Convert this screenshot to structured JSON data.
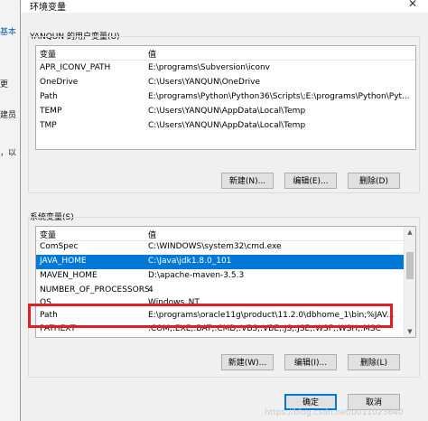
{
  "background_window": {
    "fragments": [
      {
        "text": "基本"
      },
      {
        "text": "更"
      },
      {
        "text": "建员"
      },
      {
        "text": "，以"
      }
    ]
  },
  "dialog": {
    "title": "环境变量",
    "close_glyph": "✕"
  },
  "user_vars": {
    "group_label": "YANQUN 的用户变量(U)",
    "columns": {
      "name": "变量",
      "value": "值"
    },
    "rows": [
      {
        "name": "APR_ICONV_PATH",
        "value": "E:\\programs\\Subversion\\iconv"
      },
      {
        "name": "OneDrive",
        "value": "C:\\Users\\YANQUN\\OneDrive"
      },
      {
        "name": "Path",
        "value": "E:\\programs\\Python\\Python36\\Scripts\\;E:\\programs\\Python\\Pyt..."
      },
      {
        "name": "TEMP",
        "value": "C:\\Users\\YANQUN\\AppData\\Local\\Temp"
      },
      {
        "name": "TMP",
        "value": "C:\\Users\\YANQUN\\AppData\\Local\\Temp"
      }
    ],
    "buttons": {
      "new": "新建(N)...",
      "edit": "编辑(E)...",
      "delete": "删除(D)"
    }
  },
  "system_vars": {
    "group_label": "系统变量(S)",
    "columns": {
      "name": "变量",
      "value": "值"
    },
    "rows": [
      {
        "name": "ComSpec",
        "value": "C:\\WINDOWS\\system32\\cmd.exe"
      },
      {
        "name": "JAVA_HOME",
        "value": "C:\\Java\\jdk1.8.0_101"
      },
      {
        "name": "MAVEN_HOME",
        "value": "D:\\apache-maven-3.5.3"
      },
      {
        "name": "NUMBER_OF_PROCESSORS",
        "value": "4"
      },
      {
        "name": "OS",
        "value": "Windows_NT"
      },
      {
        "name": "Path",
        "value": "E:\\programs\\oracle11g\\product\\11.2.0\\dbhome_1\\bin;%JAV..."
      },
      {
        "name": "PATHEXT",
        "value": ".COM;.EXE;.BAT;.CMD;.VBS;.VBE;.JS;.JSE;.WSF;.WSH;.MSC"
      }
    ],
    "selected_row": "JAVA_HOME",
    "highlighted_row": "Path",
    "highlight_color": "#e02020",
    "buttons": {
      "new": "新建(W)...",
      "edit": "编辑(I)...",
      "delete": "删除(L)"
    }
  },
  "footer": {
    "ok": "确定",
    "cancel": "取消"
  },
  "watermark": "https://blog.csdn.net/u011023640",
  "colors": {
    "selection": "#0078d7",
    "button_face": "#e1e1e1"
  }
}
